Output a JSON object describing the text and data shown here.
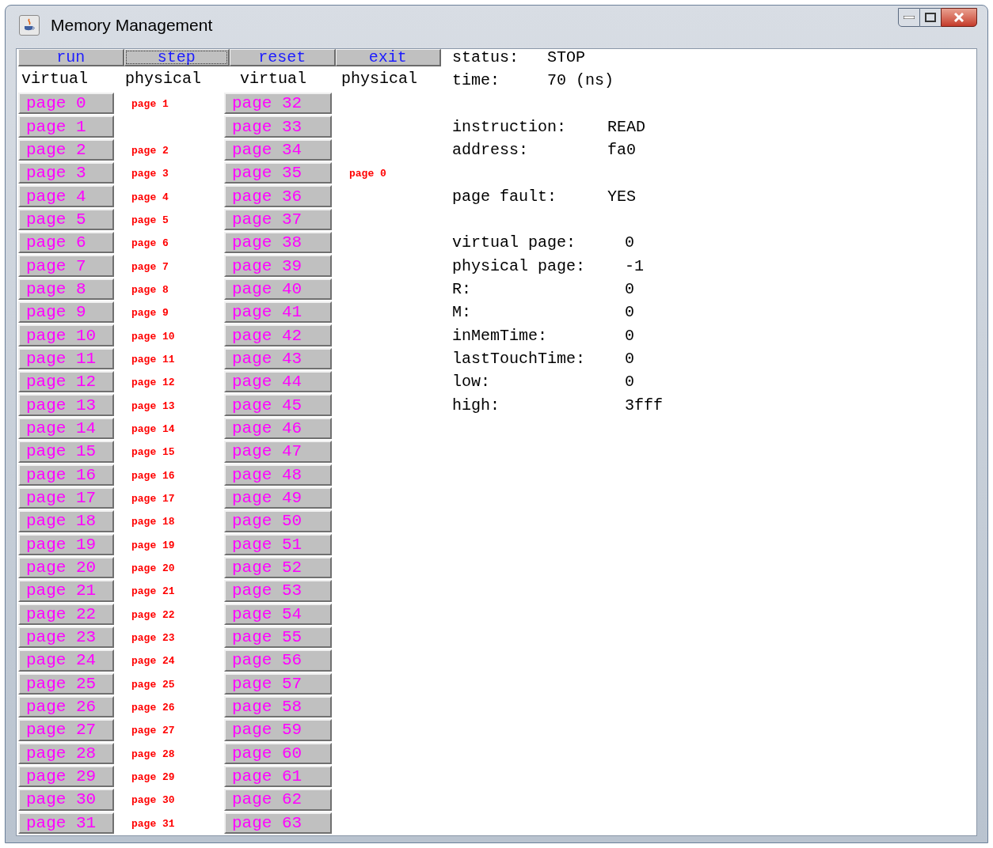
{
  "window": {
    "title": "Memory Management"
  },
  "buttons": [
    {
      "label": "run",
      "focused": false
    },
    {
      "label": "step",
      "focused": true
    },
    {
      "label": "reset",
      "focused": false
    },
    {
      "label": "exit",
      "focused": false
    }
  ],
  "headings": [
    "virtual",
    "physical",
    "virtual",
    "physical"
  ],
  "left_rows": [
    {
      "virtual": "page 0",
      "physical": "page 1"
    },
    {
      "virtual": "page 1"
    },
    {
      "virtual": "page 2",
      "physical": "page 2"
    },
    {
      "virtual": "page 3",
      "physical": "page 3"
    },
    {
      "virtual": "page 4",
      "physical": "page 4"
    },
    {
      "virtual": "page 5",
      "physical": "page 5"
    },
    {
      "virtual": "page 6",
      "physical": "page 6"
    },
    {
      "virtual": "page 7",
      "physical": "page 7"
    },
    {
      "virtual": "page 8",
      "physical": "page 8"
    },
    {
      "virtual": "page 9",
      "physical": "page 9"
    },
    {
      "virtual": "page 10",
      "physical": "page 10"
    },
    {
      "virtual": "page 11",
      "physical": "page 11"
    },
    {
      "virtual": "page 12",
      "physical": "page 12"
    },
    {
      "virtual": "page 13",
      "physical": "page 13"
    },
    {
      "virtual": "page 14",
      "physical": "page 14"
    },
    {
      "virtual": "page 15",
      "physical": "page 15"
    },
    {
      "virtual": "page 16",
      "physical": "page 16"
    },
    {
      "virtual": "page 17",
      "physical": "page 17"
    },
    {
      "virtual": "page 18",
      "physical": "page 18"
    },
    {
      "virtual": "page 19",
      "physical": "page 19"
    },
    {
      "virtual": "page 20",
      "physical": "page 20"
    },
    {
      "virtual": "page 21",
      "physical": "page 21"
    },
    {
      "virtual": "page 22",
      "physical": "page 22"
    },
    {
      "virtual": "page 23",
      "physical": "page 23"
    },
    {
      "virtual": "page 24",
      "physical": "page 24"
    },
    {
      "virtual": "page 25",
      "physical": "page 25"
    },
    {
      "virtual": "page 26",
      "physical": "page 26"
    },
    {
      "virtual": "page 27",
      "physical": "page 27"
    },
    {
      "virtual": "page 28",
      "physical": "page 28"
    },
    {
      "virtual": "page 29",
      "physical": "page 29"
    },
    {
      "virtual": "page 30",
      "physical": "page 30"
    },
    {
      "virtual": "page 31",
      "physical": "page 31"
    }
  ],
  "right_rows": [
    {
      "virtual": "page 32"
    },
    {
      "virtual": "page 33"
    },
    {
      "virtual": "page 34"
    },
    {
      "virtual": "page 35",
      "physical": "page 0"
    },
    {
      "virtual": "page 36"
    },
    {
      "virtual": "page 37"
    },
    {
      "virtual": "page 38"
    },
    {
      "virtual": "page 39"
    },
    {
      "virtual": "page 40"
    },
    {
      "virtual": "page 41"
    },
    {
      "virtual": "page 42"
    },
    {
      "virtual": "page 43"
    },
    {
      "virtual": "page 44"
    },
    {
      "virtual": "page 45"
    },
    {
      "virtual": "page 46"
    },
    {
      "virtual": "page 47"
    },
    {
      "virtual": "page 48"
    },
    {
      "virtual": "page 49"
    },
    {
      "virtual": "page 50"
    },
    {
      "virtual": "page 51"
    },
    {
      "virtual": "page 52"
    },
    {
      "virtual": "page 53"
    },
    {
      "virtual": "page 54"
    },
    {
      "virtual": "page 55"
    },
    {
      "virtual": "page 56"
    },
    {
      "virtual": "page 57"
    },
    {
      "virtual": "page 58"
    },
    {
      "virtual": "page 59"
    },
    {
      "virtual": "page 60"
    },
    {
      "virtual": "page 61"
    },
    {
      "virtual": "page 62"
    },
    {
      "virtual": "page 63"
    }
  ],
  "info_groups": [
    [
      {
        "label": "status:",
        "value": "STOP"
      },
      {
        "label": "time:",
        "value": "70 (ns)"
      }
    ],
    [
      {
        "label": "instruction:",
        "value": "READ"
      },
      {
        "label": "address:",
        "value": "fa0"
      }
    ],
    [
      {
        "label": "page fault:",
        "value": "YES"
      }
    ],
    [
      {
        "label": "virtual page:",
        "value": "0"
      },
      {
        "label": "physical page:",
        "value": "-1"
      },
      {
        "label": "R:",
        "value": "0"
      },
      {
        "label": "M:",
        "value": "0"
      },
      {
        "label": "inMemTime:",
        "value": "0"
      },
      {
        "label": "lastTouchTime:",
        "value": "0"
      },
      {
        "label": "low:",
        "value": "0"
      },
      {
        "label": "high:",
        "value": "3fff"
      }
    ]
  ]
}
